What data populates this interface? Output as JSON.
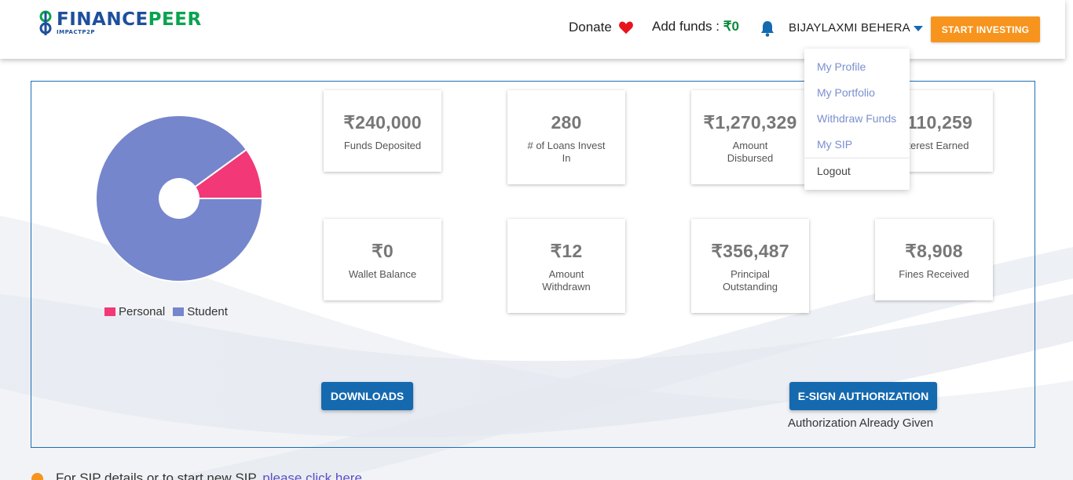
{
  "header": {
    "logo_word_a": "FINANCE",
    "logo_word_b": "PEER",
    "logo_sub": "IMPACTP2P",
    "donate_label": "Donate",
    "add_funds_label": "Add funds : ",
    "add_funds_amount": "₹0",
    "user_name": "BIJAYLAXMI BEHERA",
    "start_investing_label": "START INVESTING"
  },
  "dropdown": {
    "items": [
      "My Profile",
      "My Portfolio",
      "Withdraw Funds",
      "My SIP"
    ],
    "logout_label": "Logout"
  },
  "chart_data": {
    "type": "pie",
    "series": [
      {
        "name": "Personal",
        "value": 10,
        "color": "#f23876"
      },
      {
        "name": "Student",
        "value": 90,
        "color": "#7586cc"
      }
    ]
  },
  "legend": {
    "personal": "Personal",
    "student": "Student"
  },
  "stats": [
    {
      "value": "₹240,000",
      "label": "Funds Deposited"
    },
    {
      "value": "280",
      "label": "# of Loans Invest In"
    },
    {
      "value": "₹1,270,329",
      "label": "Amount Disbursed"
    },
    {
      "value": "₹110,259",
      "label": "Interest Earned"
    },
    {
      "value": "₹0",
      "label": "Wallet Balance"
    },
    {
      "value": "₹12",
      "label": "Amount Withdrawn"
    },
    {
      "value": "₹356,487",
      "label": "Principal Outstanding"
    },
    {
      "value": "₹8,908",
      "label": "Fines Received"
    }
  ],
  "actions": {
    "downloads_label": "DOWNLOADS",
    "esign_label": "E-SIGN AUTHORIZATION",
    "auth_status": "Authorization Already Given"
  },
  "footer": {
    "text": "For SIP details or to start new SIP,",
    "link": "please click here"
  },
  "colors": {
    "primary_blue": "#1569af",
    "accent_orange": "#f7941d",
    "personal_pink": "#f23876",
    "student_blue": "#7586cc"
  }
}
